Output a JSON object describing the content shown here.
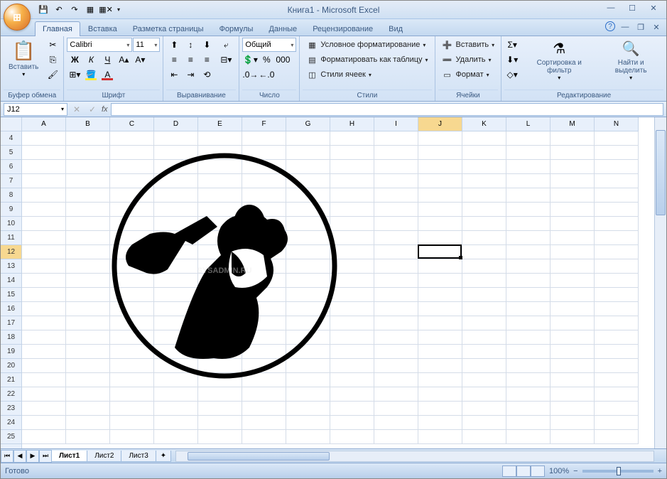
{
  "title": "Книга1 - Microsoft Excel",
  "qat_icons": [
    "save-icon",
    "undo-icon",
    "redo-icon",
    "grid-icon",
    "grid-remove-icon"
  ],
  "tabs": [
    "Главная",
    "Вставка",
    "Разметка страницы",
    "Формулы",
    "Данные",
    "Рецензирование",
    "Вид"
  ],
  "active_tab": 0,
  "ribbon": {
    "clipboard": {
      "paste": "Вставить",
      "label": "Буфер обмена"
    },
    "font": {
      "name": "Calibri",
      "size": "11",
      "label": "Шрифт",
      "bold": "Ж",
      "italic": "К",
      "underline": "Ч"
    },
    "align": {
      "label": "Выравнивание"
    },
    "number": {
      "format": "Общий",
      "label": "Число"
    },
    "styles": {
      "cond": "Условное форматирование",
      "table": "Форматировать как таблицу",
      "cell": "Стили ячеек",
      "label": "Стили"
    },
    "cells": {
      "insert": "Вставить",
      "delete": "Удалить",
      "format": "Формат",
      "label": "Ячейки"
    },
    "editing": {
      "sort": "Сортировка и фильтр",
      "find": "Найти и выделить",
      "label": "Редактирование"
    }
  },
  "namebox": "J12",
  "columns": [
    "A",
    "B",
    "C",
    "D",
    "E",
    "F",
    "G",
    "H",
    "I",
    "J",
    "K",
    "L",
    "M",
    "N"
  ],
  "rows": [
    "4",
    "5",
    "6",
    "7",
    "8",
    "9",
    "10",
    "11",
    "12",
    "13",
    "14",
    "15",
    "16",
    "17",
    "18",
    "19",
    "20",
    "21",
    "22",
    "23",
    "24",
    "25"
  ],
  "selected_col": "J",
  "selected_row": "12",
  "sheets": [
    "Лист1",
    "Лист2",
    "Лист3"
  ],
  "active_sheet": 0,
  "status": "Готово",
  "zoom": "100%",
  "watermark": "SYSADMIN.RU"
}
